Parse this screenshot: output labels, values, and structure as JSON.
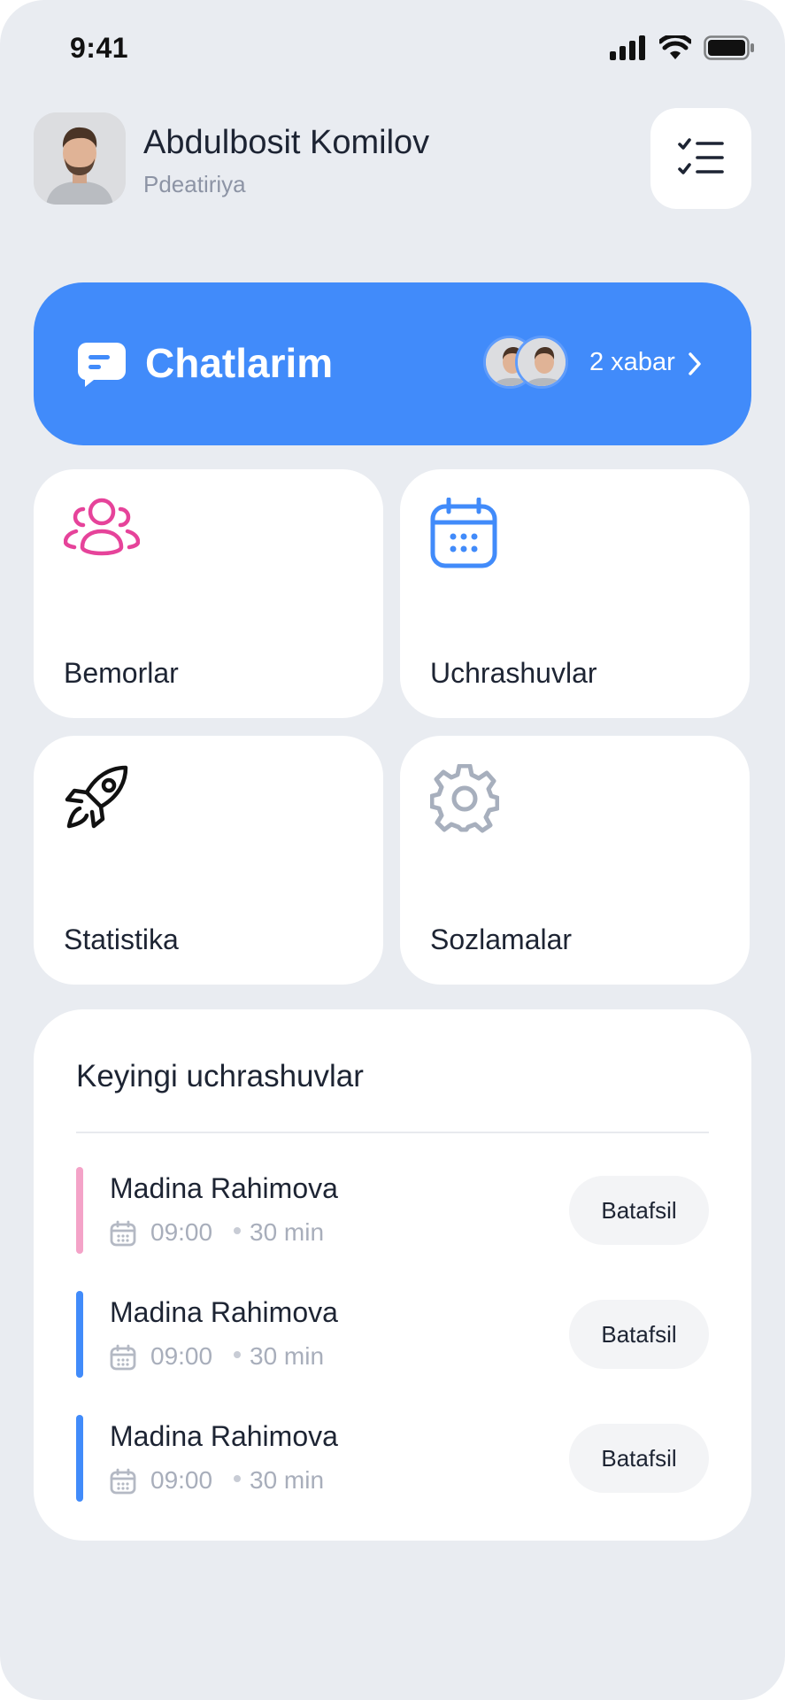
{
  "status_bar": {
    "time": "9:41"
  },
  "profile": {
    "name": "Abdulbosit Komilov",
    "role": "Pdeatiriya"
  },
  "chat_banner": {
    "title": "Chatlarim",
    "count_text": "2 xabar",
    "color": "#418bfa"
  },
  "tiles": [
    {
      "label": "Bemorlar",
      "icon": "users-icon",
      "color": "#e6439a"
    },
    {
      "label": "Uchrashuvlar",
      "icon": "calendar-icon",
      "color": "#418bfa"
    },
    {
      "label": "Statistika",
      "icon": "rocket-icon",
      "color": "#111111"
    },
    {
      "label": "Sozlamalar",
      "icon": "gear-icon",
      "color": "#a7afbd"
    }
  ],
  "upcoming": {
    "title": "Keyingi uchrashuvlar",
    "items": [
      {
        "name": "Madina Rahimova",
        "time": "09:00",
        "duration": "30 min",
        "button": "Batafsil",
        "accent": "#f4a3c8"
      },
      {
        "name": "Madina Rahimova",
        "time": "09:00",
        "duration": "30 min",
        "button": "Batafsil",
        "accent": "#418bfa"
      },
      {
        "name": "Madina Rahimova",
        "time": "09:00",
        "duration": "30 min",
        "button": "Batafsil",
        "accent": "#418bfa"
      }
    ]
  }
}
